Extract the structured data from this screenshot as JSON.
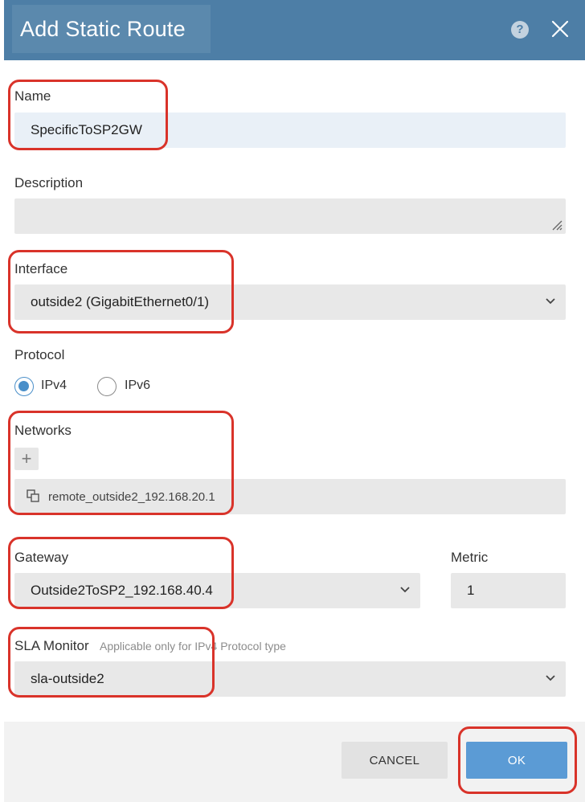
{
  "dialog": {
    "title": "Add Static Route",
    "help_glyph": "?"
  },
  "name": {
    "label": "Name",
    "value": "SpecificToSP2GW"
  },
  "description": {
    "label": "Description",
    "value": ""
  },
  "interface": {
    "label": "Interface",
    "value": "outside2 (GigabitEthernet0/1)"
  },
  "protocol": {
    "label": "Protocol",
    "options": [
      {
        "label": "IPv4",
        "checked": true
      },
      {
        "label": "IPv6",
        "checked": false
      }
    ]
  },
  "networks": {
    "label": "Networks",
    "add_glyph": "+",
    "items": [
      "remote_outside2_192.168.20.1"
    ]
  },
  "gateway": {
    "label": "Gateway",
    "value": "Outside2ToSP2_192.168.40.4"
  },
  "metric": {
    "label": "Metric",
    "value": "1"
  },
  "sla_monitor": {
    "label": "SLA Monitor",
    "hint": "Applicable only for IPv4 Protocol type",
    "value": "sla-outside2"
  },
  "footer": {
    "cancel_label": "CANCEL",
    "ok_label": "OK"
  },
  "colors": {
    "header": "#4d7ea6",
    "highlight": "#d9332a",
    "ok_button": "#5b9bd5",
    "radio_checked": "#4a8fc9"
  }
}
